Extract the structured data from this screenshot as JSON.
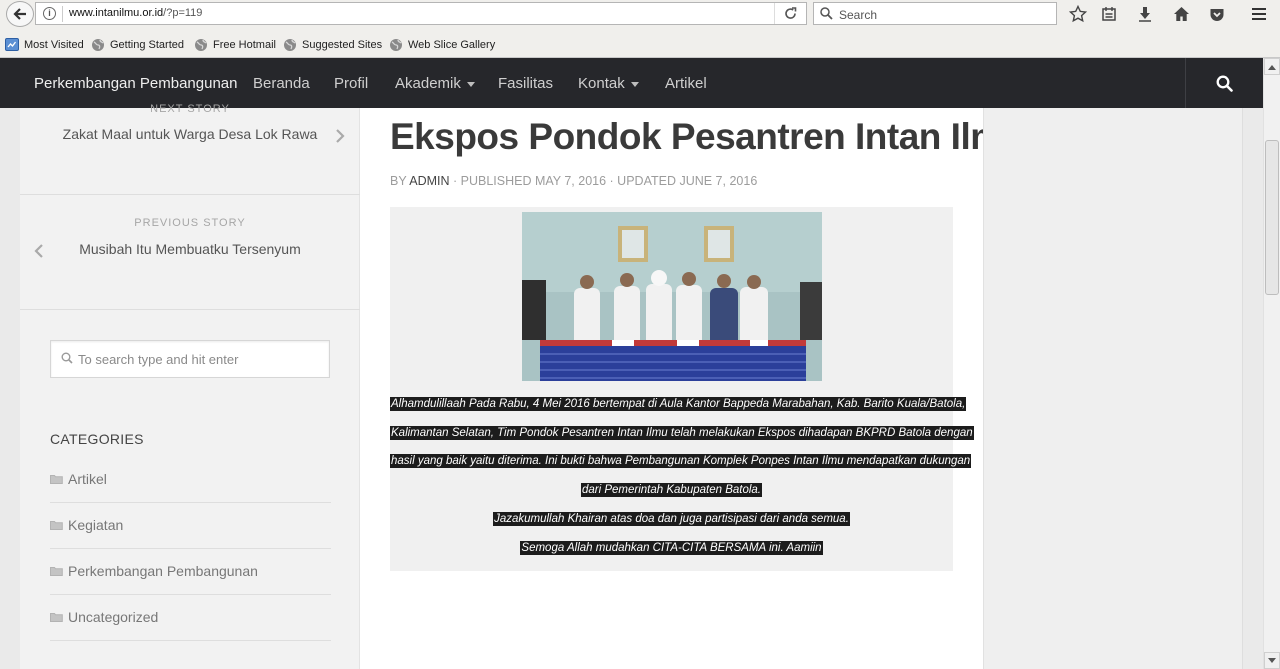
{
  "browser": {
    "url_domain": "www.intanilmu.or.id",
    "url_path": "/?p=119",
    "search_placeholder": "Search",
    "bookmarks": [
      {
        "label": "Most Visited",
        "icon": "bookmarks-folder-icon"
      },
      {
        "label": "Getting Started",
        "icon": "globe-icon"
      },
      {
        "label": "Free Hotmail",
        "icon": "globe-icon"
      },
      {
        "label": "Suggested Sites",
        "icon": "globe-icon"
      },
      {
        "label": "Web Slice Gallery",
        "icon": "globe-icon"
      }
    ],
    "toolbar_icons": [
      "star-icon",
      "reading-list-icon",
      "download-icon",
      "home-icon",
      "pocket-icon",
      "menu-icon"
    ]
  },
  "nav": {
    "brand": "Perkembangan Pembangunan",
    "items": [
      {
        "label": "Beranda"
      },
      {
        "label": "Profil"
      },
      {
        "label": "Akademik"
      },
      {
        "label": "Fasilitas"
      },
      {
        "label": "Kontak"
      },
      {
        "label": "Artikel"
      }
    ]
  },
  "sidebar": {
    "next_label": "NEXT STORY",
    "next_title": "Zakat Maal untuk Warga Desa Lok Rawa",
    "prev_label": "PREVIOUS STORY",
    "prev_title": "Musibah Itu Membuatku Tersenyum",
    "search_placeholder": "To search type and hit enter",
    "categories_heading": "CATEGORIES",
    "categories": [
      {
        "label": "Artikel"
      },
      {
        "label": "Kegiatan"
      },
      {
        "label": "Perkembangan Pembangunan"
      },
      {
        "label": "Uncategorized"
      }
    ]
  },
  "post": {
    "title": "Ekspos Pondok Pesantren Intan Ilmu",
    "meta_by": "BY ",
    "author": "ADMIN",
    "meta_rest": " · PUBLISHED MAY 7, 2016 · UPDATED JUNE 7, 2016",
    "caption_lines": [
      "Alhamdulillaah Pada Rabu, 4 Mei 2016 bertempat di Aula Kantor Bappeda Marabahan, Kab. Barito Kuala/Batola,",
      "Kalimantan Selatan, Tim Pondok Pesantren Intan Ilmu telah melakukan Ekspos dihadapan BKPRD Batola dengan",
      "hasil yang baik yaitu diterima. Ini bukti bahwa Pembangunan Komplek Ponpes Intan Ilmu mendapatkan dukungan",
      "dari Pemerintah Kabupaten Batola.",
      "Jazakumullah Khairan atas doa dan juga partisipasi dari anda semua.",
      "Semoga Allah mudahkan CITA-CITA BERSAMA ini. Aamiin"
    ]
  },
  "colors": {
    "nav_bg": "#26272b",
    "sidebar_bg": "#f2f2f2",
    "caption_highlight": "#1c1c1c"
  }
}
